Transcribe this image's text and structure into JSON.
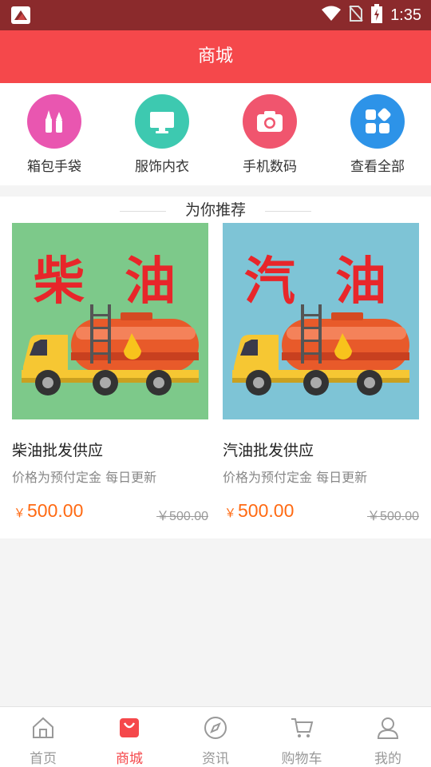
{
  "status_bar": {
    "time": "1:35"
  },
  "header": {
    "title": "商城"
  },
  "categories": [
    {
      "label": "箱包手袋",
      "icon": "makeup-icon",
      "color": "#e956b0"
    },
    {
      "label": "服饰内衣",
      "icon": "monitor-icon",
      "color": "#3dc9b0"
    },
    {
      "label": "手机数码",
      "icon": "camera-icon",
      "color": "#f0556e"
    },
    {
      "label": "查看全部",
      "icon": "grid-icon",
      "color": "#2d93e8"
    }
  ],
  "recommend": {
    "title": "为你推荐",
    "products": [
      {
        "image_text": "柴 油",
        "image_bg": "#7dc98a",
        "name": "柴油批发供应",
        "desc": "价格为预付定金 每日更新",
        "currency": "￥",
        "price": "500.00",
        "old_price": "￥500.00"
      },
      {
        "image_text": "汽 油",
        "image_bg": "#7ec4d6",
        "name": "汽油批发供应",
        "desc": "价格为预付定金 每日更新",
        "currency": "￥",
        "price": "500.00",
        "old_price": "￥500.00"
      }
    ]
  },
  "bottom_nav": [
    {
      "label": "首页",
      "icon": "home-icon",
      "active": false
    },
    {
      "label": "商城",
      "icon": "shopping-bag-icon",
      "active": true
    },
    {
      "label": "资讯",
      "icon": "compass-icon",
      "active": false
    },
    {
      "label": "购物车",
      "icon": "cart-icon",
      "active": false
    },
    {
      "label": "我的",
      "icon": "user-icon",
      "active": false
    }
  ],
  "colors": {
    "accent": "#f5484b",
    "status_bar": "#8b2a2c",
    "price": "#ff6a13"
  }
}
